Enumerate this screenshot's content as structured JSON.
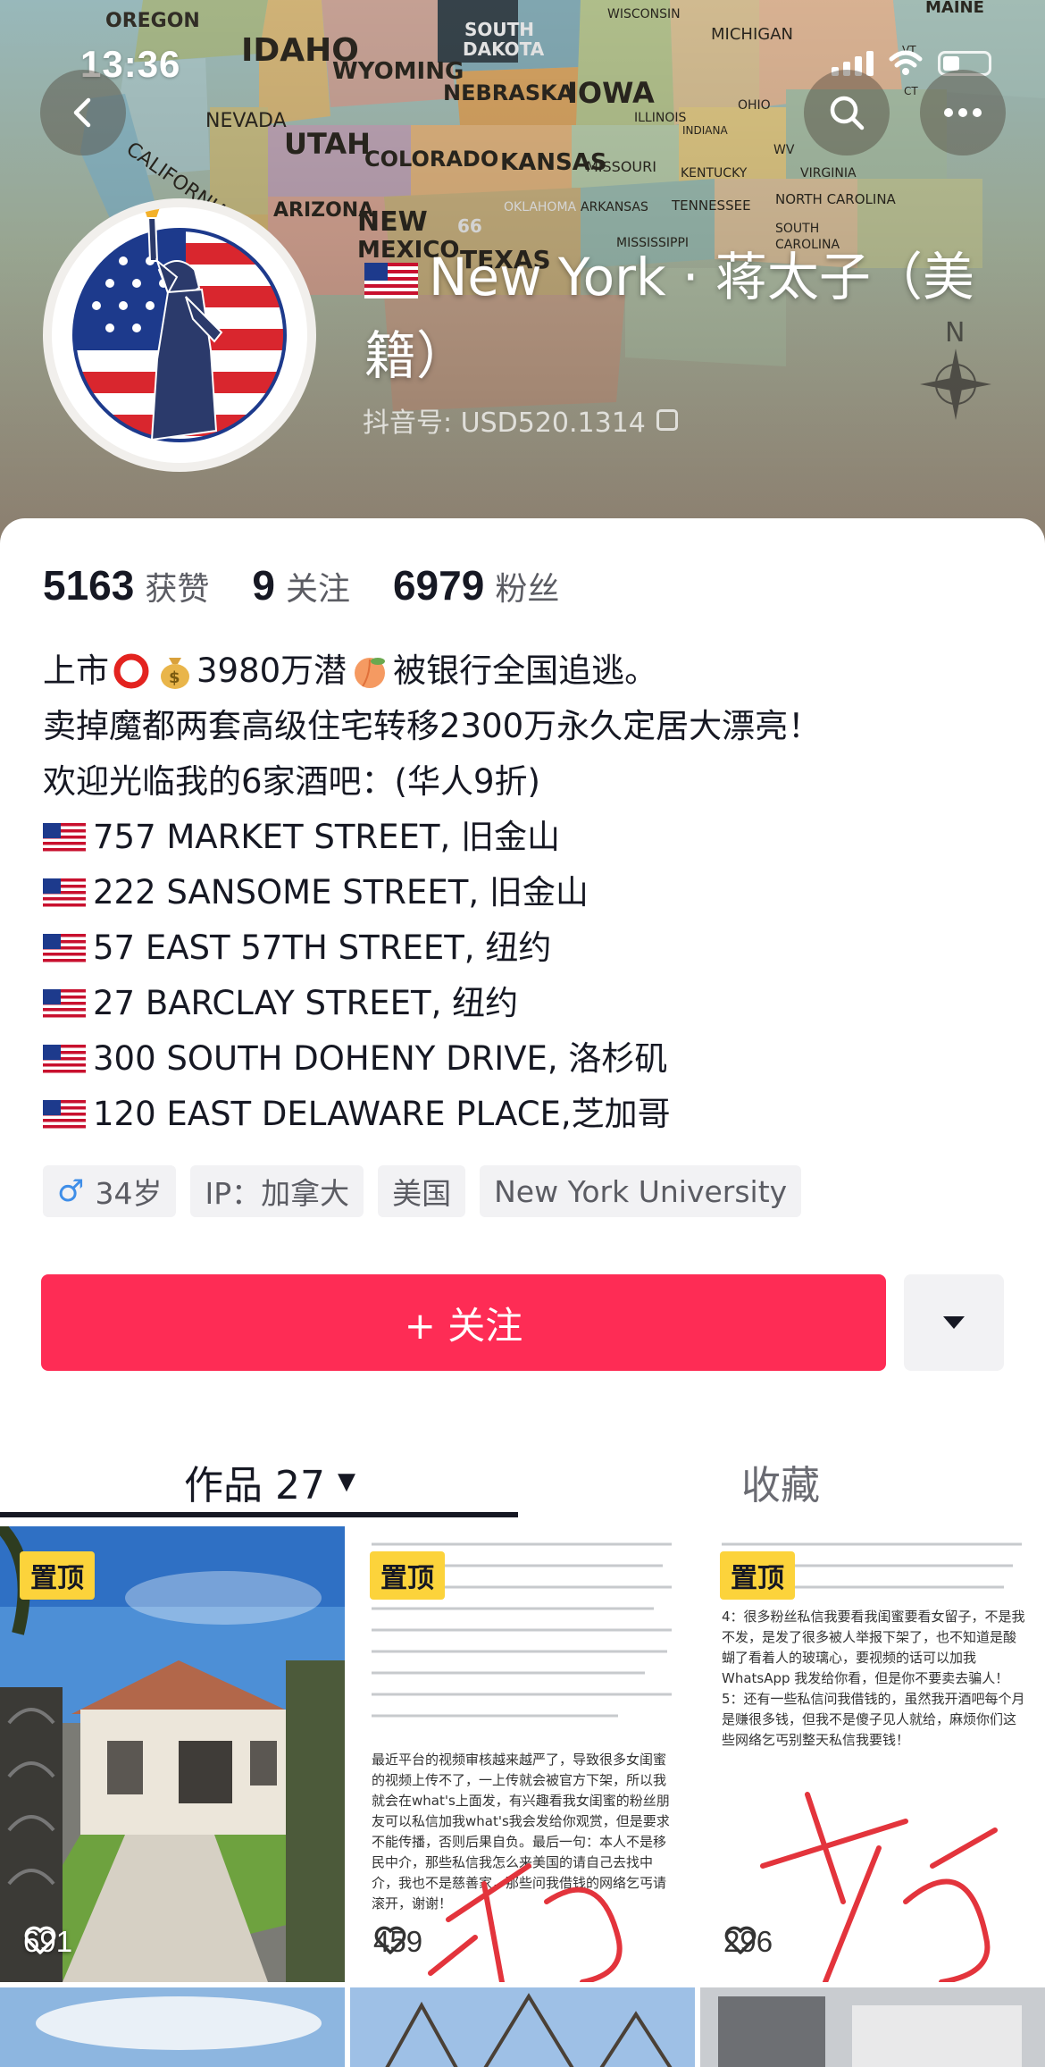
{
  "status_bar": {
    "time": "13:36"
  },
  "header": {
    "nickname": "New York · 蒋太子（美籍）",
    "douyin_id": "抖音号: USD520.1314",
    "map_labels": [
      "OREGON",
      "IDAHO",
      "WYOMING",
      "SOUTH DAKOTA",
      "NEBRASKA",
      "IOWA",
      "NEVADA",
      "UTAH",
      "COLORADO",
      "KANSAS",
      "CALIFORNIA",
      "ARIZONA",
      "NEW MEXICO",
      "MICHIGAN",
      "OHIO",
      "TEXAS",
      "ILLINOIS",
      "MISSOURI",
      "OKLAHOMA",
      "ARKANSAS",
      "KENTUCKY",
      "TENNESSEE",
      "VIRGINIA",
      "NORTH CAROLINA",
      "SOUTH CAROLINA",
      "MISSISSIPPI",
      "INDIANA",
      "WISCONSIN",
      "MAINE",
      "MAINE",
      "VT",
      "CT",
      "WV",
      "66",
      "N"
    ]
  },
  "stats": [
    {
      "value": "5163",
      "label": "获赞"
    },
    {
      "value": "9",
      "label": "关注"
    },
    {
      "value": "6979",
      "label": "粉丝"
    }
  ],
  "bio": {
    "line1_a": "上市",
    "line1_b": "3980万潜",
    "line1_c": "被银行全国追逃。",
    "line2": "卖掉魔都两套高级住宅转移2300万永久定居大漂亮！",
    "line3": "欢迎光临我的6家酒吧：(华人9折)",
    "addresses": [
      "757 MARKET STREET, 旧金山",
      "222 SANSOME STREET, 旧金山",
      "57 EAST 57TH STREET, 纽约",
      "27 BARCLAY STREET, 纽约",
      "300 SOUTH DOHENY DRIVE, 洛杉矶",
      "120 EAST DELAWARE PLACE,芝加哥"
    ]
  },
  "tags": [
    {
      "icon": "male-icon",
      "text": "34岁"
    },
    {
      "text": "IP：加拿大"
    },
    {
      "text": "美国"
    },
    {
      "text": "New York University"
    }
  ],
  "follow_button": {
    "label": "+ 关注"
  },
  "tabs": {
    "works": "作品 27",
    "favorites": "收藏"
  },
  "videos": [
    {
      "pinned": "置顶",
      "likes": "691"
    },
    {
      "pinned": "置顶",
      "likes": "459",
      "text": "最近平台的视频审核越来越严了，导致很多女闺蜜的视频上传不了，一上传就会被官方下架，所以我就会在what's上面发，有兴趣看我女闺蜜的粉丝朋友可以私信加我what's我会发给你观赏，但是要求不能传播，否则后果自负。最后一句：本人不是移民中介，那些私信我怎么来美国的请自己去找中介，我也不是慈善家，那些问我借钱的网络乞丐请滚开，谢谢！"
    },
    {
      "pinned": "置顶",
      "likes": "296",
      "text": "4：很多粉丝私信我要看我闺蜜要看女留子，不是我不发，是发了很多被人举报下架了，也不知道是酸蝴了看着人的玻璃心，要视频的话可以加我WhatsApp 我发给你看，但是你不要卖去骗人！5：还有一些私信问我借钱的，虽然我开酒吧每个月是赚很多钱，但我不是傻子见人就给，麻烦你们这些网络乞丐别整天私信我要钱！"
    }
  ],
  "colors": {
    "accent": "#fe2c55",
    "pin": "#fcd33b",
    "male": "#3f8ee8"
  }
}
